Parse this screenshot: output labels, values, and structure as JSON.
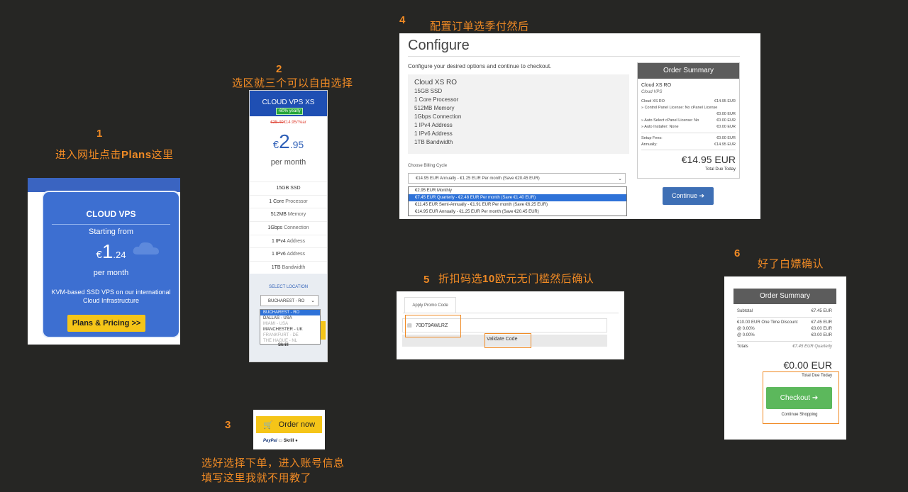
{
  "steps": [
    {
      "num": "1",
      "text_pre": "进入网址点击",
      "text_bold": "Plans",
      "text_post": "这里"
    },
    {
      "num": "2",
      "text": "选区就三个可以自由选择"
    },
    {
      "num": "3",
      "text_line1": "选好选择下单，进入账号信息",
      "text_line2": "填写这里我就不用教了"
    },
    {
      "num": "4",
      "text": "配置订单选季付然后"
    },
    {
      "num": "5",
      "text_pre": "折扣码选",
      "text_bold": "10",
      "text_post": "欧元无门槛然后确认"
    },
    {
      "num": "6",
      "text": "好了白嫖确认"
    }
  ],
  "panel1": {
    "title": "CLOUD VPS",
    "starting_from": "Starting from",
    "currency": "€",
    "price_big": "1",
    "price_cents": ".24",
    "per_month": "per month",
    "desc_line1": "KVM-based SSD VPS on our international",
    "desc_line2": "Cloud Infrastructure",
    "button": "Plans & Pricing >>",
    "icons": {
      "cloud": "cloud-icon"
    }
  },
  "panel2": {
    "title": "CLOUD VPS XS",
    "badge": "-60% yearly",
    "old_price": "€35.40",
    "new_price": "€14.95/Year",
    "currency": "€",
    "price_big": "2",
    "price_cents": ".95",
    "per_month": "per month",
    "features": [
      {
        "value": "15GB SSD",
        "label": ""
      },
      {
        "value": "1 Core",
        "label": " Processor"
      },
      {
        "value": "512MB",
        "label": " Memory"
      },
      {
        "value": "1Gbps",
        "label": " Connection"
      },
      {
        "value": "1 IPv4",
        "label": " Address"
      },
      {
        "value": "1 IPv6",
        "label": " Address"
      },
      {
        "value": "1TB",
        "label": " Bandwidth"
      }
    ],
    "location_label": "SELECT LOCATION",
    "location_selected": "BUCHAREST - RO",
    "location_options": [
      {
        "label": "BUCHAREST - RO",
        "state": "on"
      },
      {
        "label": "DALLAS - USA",
        "state": ""
      },
      {
        "label": "MIAMI - USA",
        "state": "dim"
      },
      {
        "label": "MANCHESTER - UK",
        "state": ""
      },
      {
        "label": "FRANKFURT - DE",
        "state": "dim"
      },
      {
        "label": "THE HAGUE - NL",
        "state": "dim"
      }
    ],
    "payment_text": "Skrill"
  },
  "panel3": {
    "button": "Order now",
    "paypal": "PayPal",
    "skrill": "Skrill"
  },
  "panel4": {
    "heading": "Configure",
    "subtitle": "Configure your desired options and continue to checkout.",
    "product_name": "Cloud XS RO",
    "specs": [
      "15GB SSD",
      "1 Core Processor",
      "512MB Memory",
      "1Gbps Connection",
      "1 IPv4 Address",
      "1 IPv6 Address",
      "1TB Bandwidth"
    ],
    "billing_label": "Choose Billing Cycle",
    "billing_selected": "€14.95 EUR Annually - €1.25 EUR Per month (Save €20.45 EUR)",
    "billing_options": [
      {
        "label": "€2.95 EUR Monthly",
        "state": ""
      },
      {
        "label": "€7.45 EUR Quarterly - €2.48 EUR Per month (Save €1.40 EUR)",
        "state": "on"
      },
      {
        "label": "€11.45 EUR Semi-Annually - €1.91 EUR Per month (Save €6.25 EUR)",
        "state": ""
      },
      {
        "label": "€14.95 EUR Annually - €1.25 EUR Per month (Save €20.45 EUR)",
        "state": ""
      }
    ],
    "summary": {
      "title": "Order Summary",
      "product": "Cloud XS RO",
      "group": "Cloud VPS",
      "rows": [
        {
          "l": "Cloud XS RO",
          "r": "€14.95 EUR"
        },
        {
          "l": "» Control Panel License: No cPanel License",
          "r": ""
        },
        {
          "l": "",
          "r": "€0.00 EUR"
        },
        {
          "l": "» Auto Select cPanel License: No",
          "r": "€0.00 EUR"
        },
        {
          "l": "» Auto Installer: None",
          "r": "€0.00 EUR"
        }
      ],
      "setup_label": "Setup Fees:",
      "setup_value": "€0.00 EUR",
      "annual_label": "Annually:",
      "annual_value": "€14.95 EUR",
      "total": "€14.95 EUR",
      "total_label": "Total Due Today"
    },
    "continue_button": "Continue ➔"
  },
  "panel5": {
    "tab": "Apply Promo Code",
    "code_value": "70DT9AWLRZ",
    "validate": "Validate Code"
  },
  "panel6": {
    "title": "Order Summary",
    "subtotal_label": "Subtotal",
    "subtotal_value": "€7.45 EUR",
    "discount_label": "€10.00 EUR One Time Discount",
    "discount_value": "€7.45 EUR",
    "tax1_label": "@ 0.00%",
    "tax1_value": "€0.00 EUR",
    "tax2_label": "@ 0.00%",
    "tax2_value": "€0.00 EUR",
    "totals_label": "Totals",
    "totals_value": "€7.45 EUR Quarterly",
    "total": "€0.00 EUR",
    "total_label": "Total Due Today",
    "checkout": "Checkout ➔",
    "continue_shopping": "Continue Shopping"
  }
}
